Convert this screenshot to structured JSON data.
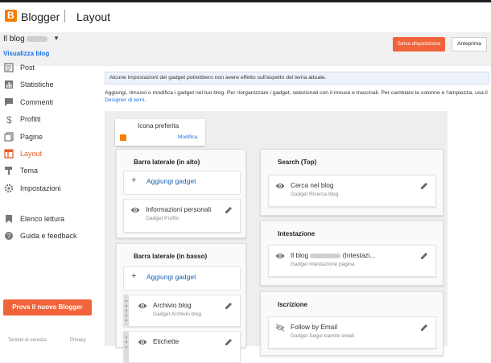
{
  "header": {
    "brand": "Blogger",
    "section": "Layout",
    "logo_letter": "B"
  },
  "blog": {
    "name_prefix": "Il blog",
    "view_link": "Visualizza blog"
  },
  "actions": {
    "save": "Salva disposizione",
    "preview": "Anteprima"
  },
  "sidebar": {
    "items": [
      {
        "label": "Post",
        "icon": "posts-icon"
      },
      {
        "label": "Statistiche",
        "icon": "stats-icon"
      },
      {
        "label": "Commenti",
        "icon": "comments-icon"
      },
      {
        "label": "Profitti",
        "icon": "dollar-icon"
      },
      {
        "label": "Pagine",
        "icon": "pages-icon"
      },
      {
        "label": "Layout",
        "icon": "layout-icon",
        "active": true
      },
      {
        "label": "Tema",
        "icon": "theme-icon"
      },
      {
        "label": "Impostazioni",
        "icon": "settings-icon"
      },
      {
        "label": "Elenco lettura",
        "icon": "bookmark-icon"
      },
      {
        "label": "Guida e feedback",
        "icon": "help-icon"
      }
    ],
    "cta": "Prova il nuovo Blogger",
    "footer": {
      "terms": "Termini di servizio",
      "privacy": "Privacy"
    }
  },
  "notice": "Alcune impostazioni dei gadget potrebbero non avere effetto sull'aspetto del tema attuale.",
  "intro": {
    "text": "Aggiungi, rimuovi o modifica i gadget nel tuo blog. Per riorganizzare i gadget, selezionali con il mouse e trascinali. Per cambiare le colonne e l'ampiezza, usa il",
    "link": "Designer di temi",
    "end": "."
  },
  "favicon": {
    "title": "Icona preferita",
    "edit": "Modifica"
  },
  "sections": {
    "sidebar_top": {
      "title": "Barra laterale (in alto)",
      "add": "Aggiungi gadget",
      "gadgets": [
        {
          "title": "Informazioni personali",
          "subtitle": "Gadget Profilo"
        }
      ]
    },
    "sidebar_bottom": {
      "title": "Barra laterale (in basso)",
      "add": "Aggiungi gadget",
      "gadgets": [
        {
          "title": "Archivio blog",
          "subtitle": "Gadget Archivio blog"
        },
        {
          "title": "Etichette",
          "subtitle": ""
        }
      ]
    },
    "search_top": {
      "title": "Search (Top)",
      "gadgets": [
        {
          "title": "Cerca nel blog",
          "subtitle": "Gadget Ricerca blog"
        }
      ]
    },
    "header": {
      "title": "Intestazione",
      "gadgets": [
        {
          "title_prefix": "Il blog",
          "title_suffix": "(Intestazi...",
          "subtitle": "Gadget Intestazione pagina"
        }
      ]
    },
    "subscribe": {
      "title": "Iscrizione",
      "gadgets": [
        {
          "title": "Follow by Email",
          "subtitle": "Gadget Segui tramite email"
        }
      ]
    }
  },
  "colors": {
    "accent": "#f1643b",
    "link": "#1a73e8",
    "active_nav": "#e5622e"
  }
}
